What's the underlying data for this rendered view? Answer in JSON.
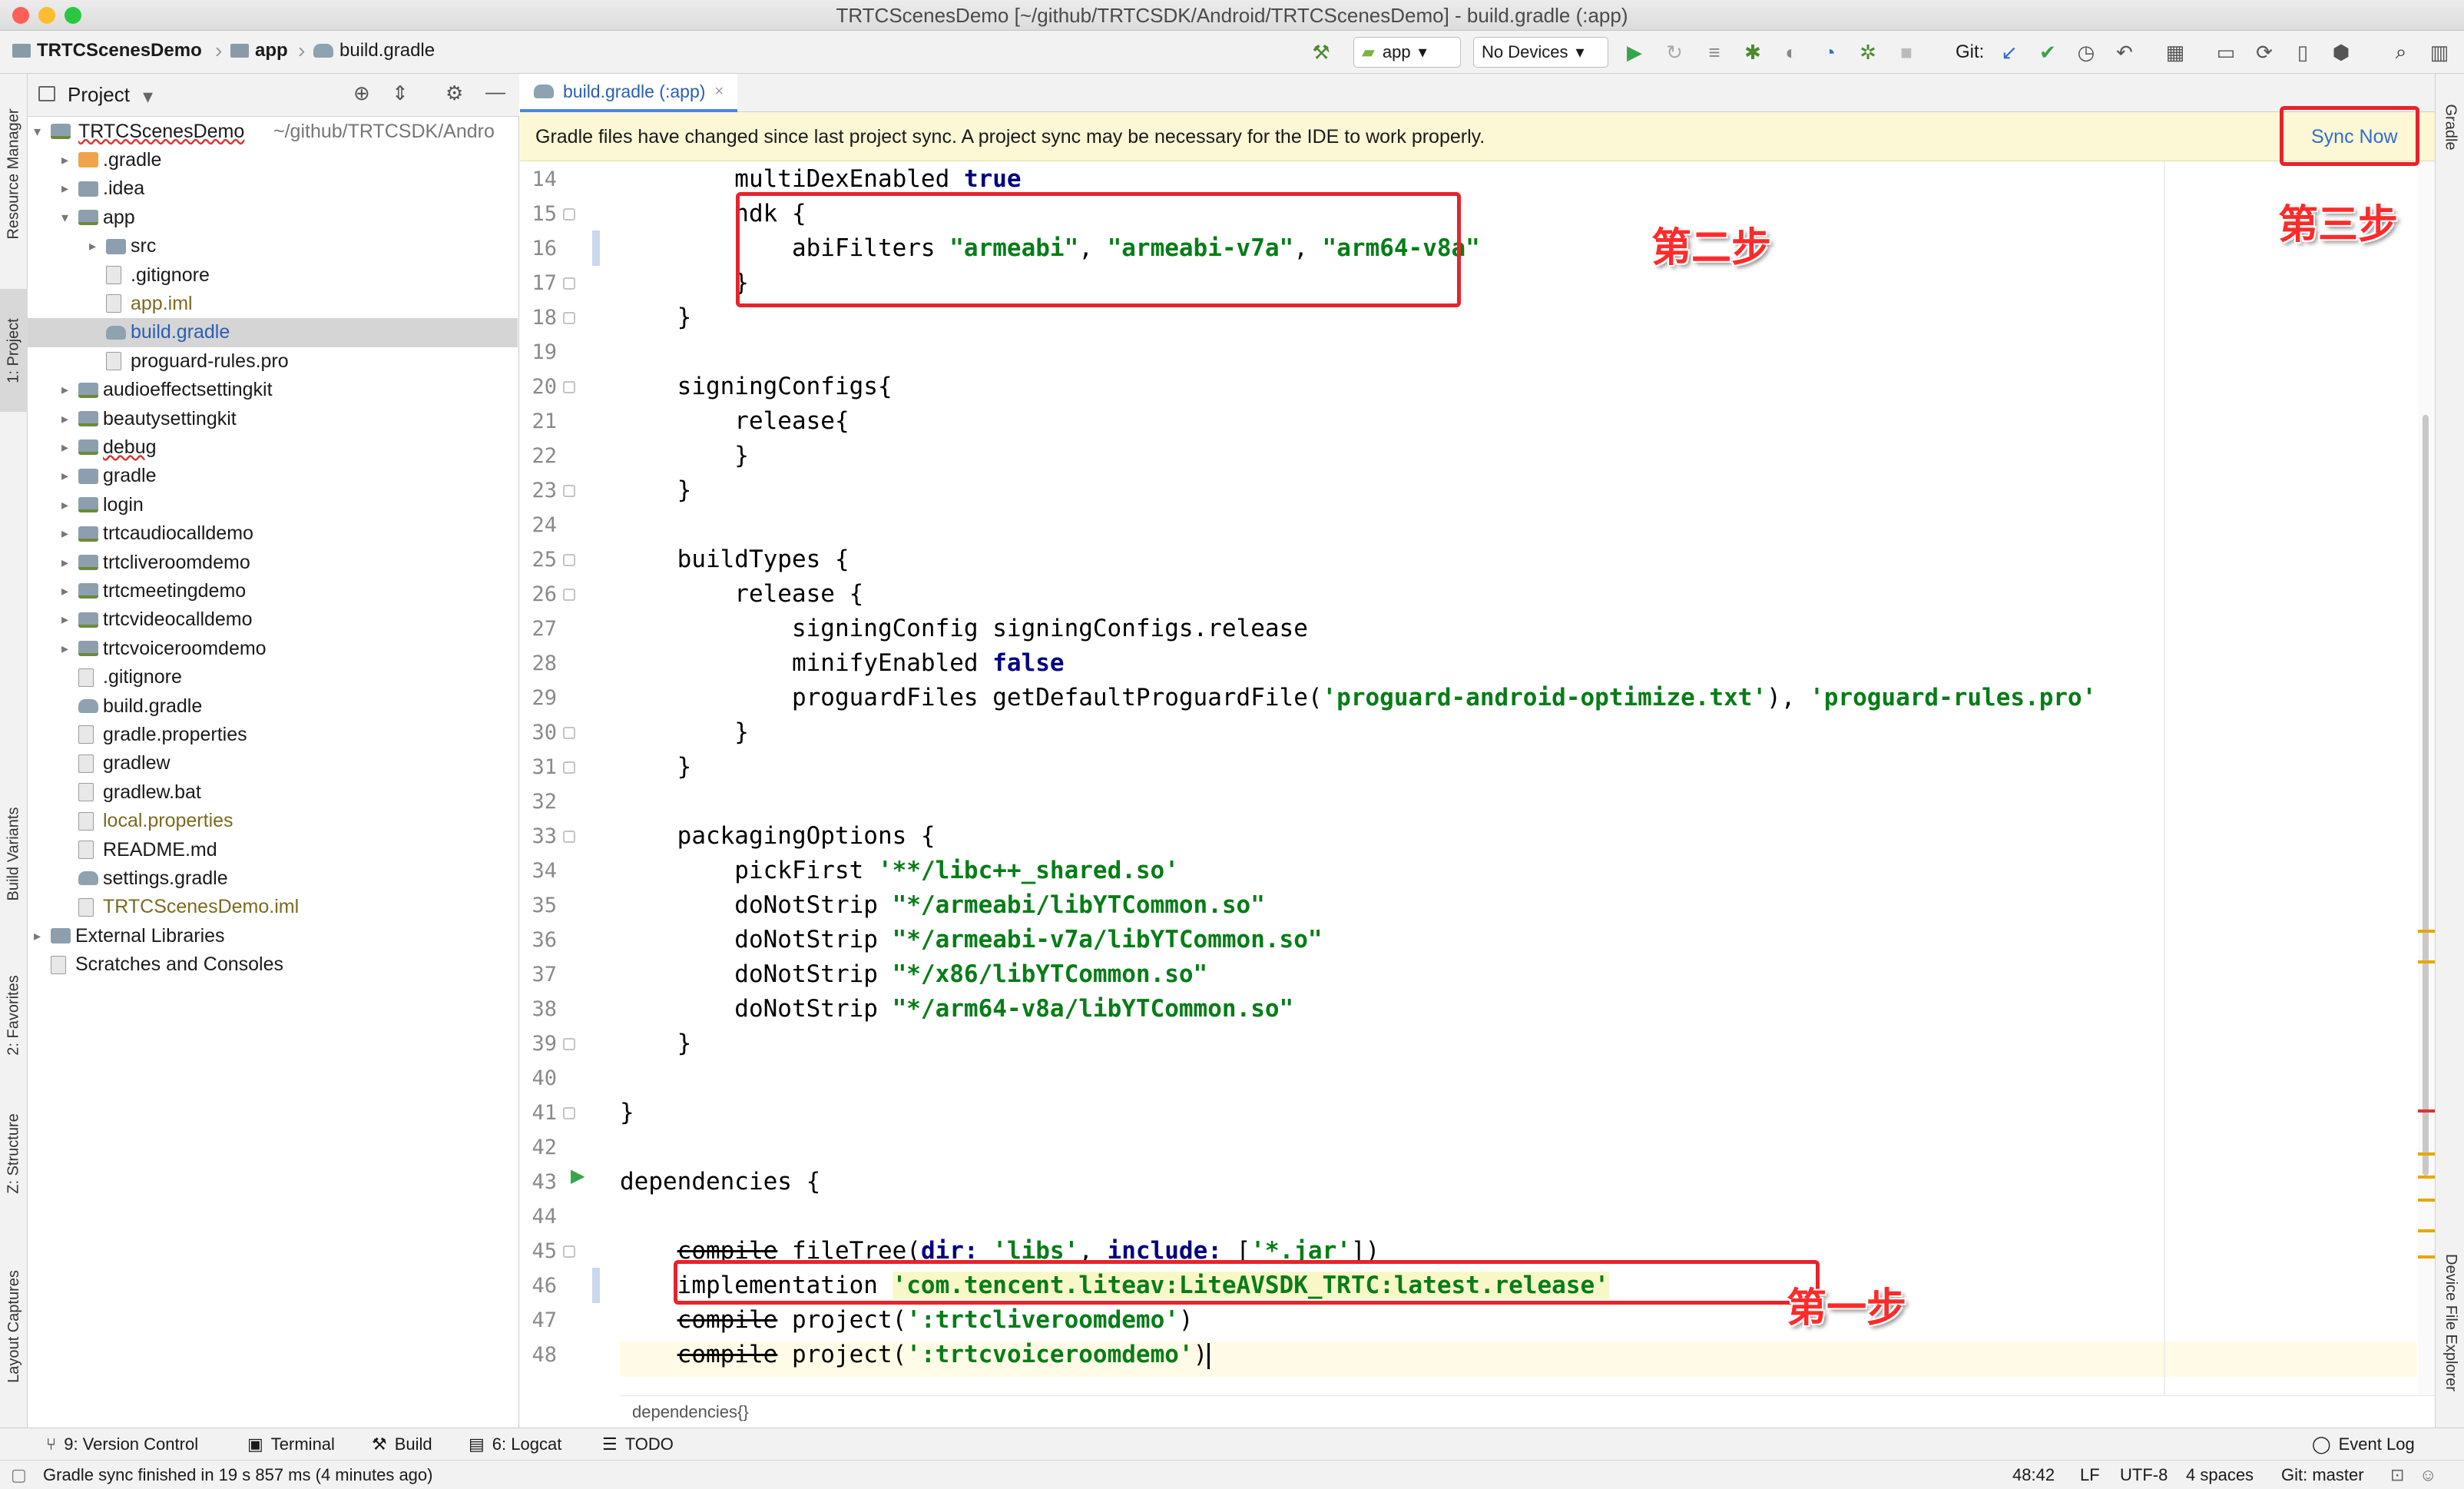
{
  "window": {
    "title": "TRTCScenesDemo [~/github/TRTCSDK/Android/TRTCScenesDemo] - build.gradle (:app)"
  },
  "nav": {
    "breadcrumbs": [
      "TRTCScenesDemo",
      "app",
      "build.gradle"
    ],
    "run_config": "app",
    "device": "No Devices",
    "git_label": "Git:"
  },
  "left_stripe": {
    "tabs": [
      "Resource Manager",
      "1: Project",
      "Build Variants",
      "2: Favorites",
      "Z: Structure",
      "Layout Captures"
    ]
  },
  "right_stripe": {
    "tabs": [
      "Gradle",
      "Device File Explorer"
    ]
  },
  "project_panel": {
    "title": "Project",
    "root": {
      "name": "TRTCScenesDemo",
      "path": "~/github/TRTCSDK/Andro"
    },
    "items": [
      {
        "label": ".gradle"
      },
      {
        "label": ".idea"
      },
      {
        "label": "app"
      },
      {
        "label": "src"
      },
      {
        "label": ".gitignore"
      },
      {
        "label": "app.iml"
      },
      {
        "label": "build.gradle"
      },
      {
        "label": "proguard-rules.pro"
      },
      {
        "label": "audioeffectsettingkit"
      },
      {
        "label": "beautysettingkit"
      },
      {
        "label": "debug"
      },
      {
        "label": "gradle"
      },
      {
        "label": "login"
      },
      {
        "label": "trtcaudiocalldemo"
      },
      {
        "label": "trtcliveroomdemo"
      },
      {
        "label": "trtcmeetingdemo"
      },
      {
        "label": "trtcvideocalldemo"
      },
      {
        "label": "trtcvoiceroomdemo"
      },
      {
        "label": ".gitignore"
      },
      {
        "label": "build.gradle"
      },
      {
        "label": "gradle.properties"
      },
      {
        "label": "gradlew"
      },
      {
        "label": "gradlew.bat"
      },
      {
        "label": "local.properties"
      },
      {
        "label": "README.md"
      },
      {
        "label": "settings.gradle"
      },
      {
        "label": "TRTCScenesDemo.iml"
      },
      {
        "label": "External Libraries"
      },
      {
        "label": "Scratches and Consoles"
      }
    ]
  },
  "editor": {
    "tab_label": "build.gradle (:app)",
    "banner_text": "Gradle files have changed since last project sync. A project sync may be necessary for the IDE to work properly.",
    "sync_now": "Sync Now",
    "line_numbers": [
      "14",
      "15",
      "16",
      "17",
      "18",
      "19",
      "20",
      "21",
      "22",
      "23",
      "24",
      "25",
      "26",
      "27",
      "28",
      "29",
      "30",
      "31",
      "32",
      "33",
      "34",
      "35",
      "36",
      "37",
      "38",
      "39",
      "40",
      "41",
      "42",
      "43",
      "44",
      "45",
      "46",
      "47",
      "48"
    ],
    "code": {
      "l14a": "        multiDexEnabled ",
      "l14b": "true",
      "l15": "        ndk {",
      "l16a": "            abiFilters ",
      "l16b": "\"armeabi\"",
      "l16c": ", ",
      "l16d": "\"armeabi-v7a\"",
      "l16e": ", ",
      "l16f": "\"arm64-v8a\"",
      "l17": "        }",
      "l18": "    }",
      "l20": "    signingConfigs{",
      "l21": "        release{",
      "l22": "        }",
      "l23": "    }",
      "l25": "    buildTypes {",
      "l26": "        release {",
      "l27": "            signingConfig signingConfigs.release",
      "l28a": "            minifyEnabled ",
      "l28b": "false",
      "l29a": "            proguardFiles getDefaultProguardFile(",
      "l29b": "'proguard-android-optimize.txt'",
      "l29c": "), ",
      "l29d": "'proguard-rules.pro'",
      "l30": "        }",
      "l31": "    }",
      "l33": "    packagingOptions {",
      "l34a": "        pickFirst ",
      "l34b": "'**/libc++_shared.so'",
      "l35a": "        doNotStrip ",
      "l35b": "\"*/armeabi/libYTCommon.so\"",
      "l36a": "        doNotStrip ",
      "l36b": "\"*/armeabi-v7a/libYTCommon.so\"",
      "l37a": "        doNotStrip ",
      "l37b": "\"*/x86/libYTCommon.so\"",
      "l38a": "        doNotStrip ",
      "l38b": "\"*/arm64-v8a/libYTCommon.so\"",
      "l39": "    }",
      "l41": "}",
      "l43": "dependencies {",
      "l45a": "    ",
      "l45b": "compile",
      "l45c": " fileTree(",
      "l45d": "dir: ",
      "l45e": "'libs'",
      "l45f": ", ",
      "l45g": "include: ",
      "l45h": "[",
      "l45i": "'*.jar'",
      "l45j": "])",
      "l46a": "    implementation ",
      "l46b": "'com.tencent.liteav:LiteAVSDK_TRTC:latest.release'",
      "l47a": "    ",
      "l47b": "compile",
      "l47c": " project(",
      "l47d": "':trtcliveroomdemo'",
      "l47e": ")",
      "l48a": "    ",
      "l48b": "compile",
      "l48c": " project(",
      "l48d": "':trtcvoiceroomdemo'",
      "l48e": ")"
    },
    "breadcrumb": "dependencies{}"
  },
  "annotations": {
    "step1": "第一步",
    "step2": "第二步",
    "step3": "第三步"
  },
  "bottom_tools": [
    "9: Version Control",
    "Terminal",
    "Build",
    "6: Logcat",
    "TODO",
    "Event Log"
  ],
  "status": {
    "message": "Gradle sync finished in 19 s 857 ms (4 minutes ago)",
    "position": "48:42",
    "line_sep": "LF",
    "encoding": "UTF-8",
    "indent": "4 spaces",
    "git": "Git: master"
  },
  "colors": {
    "keyword": "#000080",
    "string": "#067d17",
    "annotation": "#e8232a",
    "banner": "#fcf7d4",
    "selection": "#d5d5d5"
  }
}
